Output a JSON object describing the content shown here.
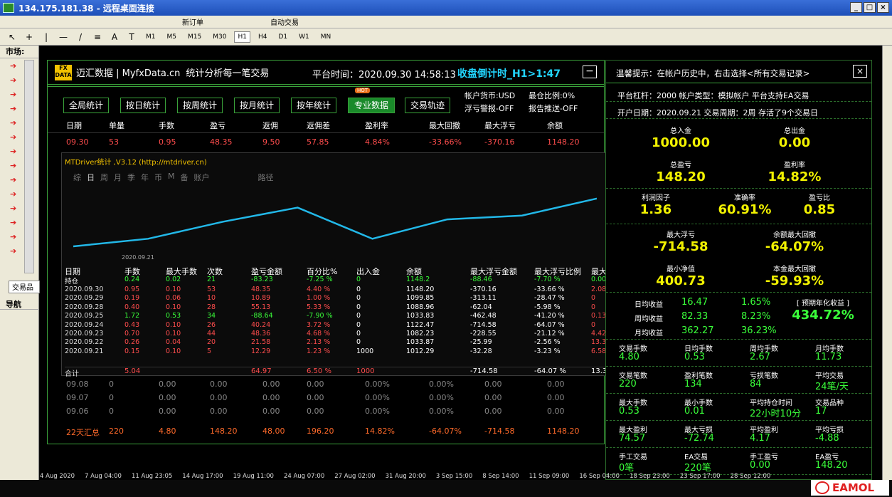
{
  "window": {
    "title": "134.175.181.38 - 远程桌面连接"
  },
  "toolbar_top": {
    "items": [
      "新订单",
      "自动交易"
    ]
  },
  "toolbar": {
    "timeframes": [
      "M1",
      "M5",
      "M15",
      "M30",
      "H1",
      "H4",
      "D1",
      "W1",
      "MN"
    ],
    "active": "H1"
  },
  "left_panel": {
    "market_title": "市场:",
    "tab_label": "交易品",
    "nav_title": "导航"
  },
  "main_panel": {
    "brand": "迈汇数据 | MyfxData.cn",
    "slogan": "统计分析每一笔交易",
    "platform_time": "平台时间：2020.09.30 14:58:13",
    "countdown": "收盘倒计时_H1>1:47",
    "tabs": [
      "全局统计",
      "按日统计",
      "按周统计",
      "按月统计",
      "按年统计",
      "专业数据",
      "交易轨迹"
    ],
    "active_tab": "专业数据",
    "hot_badge": "HOT",
    "info": [
      "帐户货币:USD",
      "浮亏警报-OFF",
      "最仓比例:0%",
      "报告推送-OFF"
    ],
    "columns": [
      "日期",
      "单量",
      "手数",
      "盈亏",
      "返佣",
      "返佣差",
      "盈利率",
      "最大回撤",
      "最大浮亏",
      "余额"
    ],
    "rows": [
      [
        "09.30",
        "53",
        "0.95",
        "48.35",
        "9.50",
        "57.85",
        "4.84%",
        "-33.66%",
        "-370.16",
        "1148.20"
      ]
    ],
    "grey_rows": [
      [
        "09.08",
        "0",
        "0.00",
        "0.00",
        "0.00",
        "0.00",
        "0.00%",
        "0.00%",
        "0.00",
        "0.00"
      ],
      [
        "09.07",
        "0",
        "0.00",
        "0.00",
        "0.00",
        "0.00",
        "0.00%",
        "0.00%",
        "0.00",
        "0.00"
      ],
      [
        "09.06",
        "0",
        "0.00",
        "0.00",
        "0.00",
        "0.00",
        "0.00%",
        "0.00%",
        "0.00",
        "0.00"
      ]
    ],
    "summary": [
      "22天汇总",
      "220",
      "4.80",
      "148.20",
      "48.00",
      "196.20",
      "14.82%",
      "-64.07%",
      "-714.58",
      "1148.20"
    ]
  },
  "sub_panel": {
    "title": "MTDriver统计 ,V3.12 (http://mtdriver.cn)",
    "tabs": [
      "综",
      "日",
      "周",
      "月",
      "季",
      "年",
      "币",
      "M",
      "备",
      "账户",
      "路径"
    ],
    "axis_date": "2020.09.21",
    "columns": [
      "日期",
      "手数",
      "最大手数",
      "次数",
      "盈亏金额",
      "百分比%",
      "出入金",
      "余额",
      "最大浮亏金额",
      "最大浮亏比例",
      "最大"
    ],
    "chart_data": {
      "type": "line",
      "x": [
        "09.21",
        "09.22",
        "09.23",
        "09.24",
        "09.25",
        "09.28",
        "09.29",
        "09.30"
      ],
      "values": [
        1012.29,
        1033.87,
        1082.23,
        1122.47,
        1033.83,
        1088.96,
        1099.85,
        1148.2
      ]
    },
    "hold_row": [
      "持仓",
      "0.24",
      "0.02",
      "21",
      "-83.23",
      "-7.25 %",
      "0",
      "1148.2",
      "-88.46",
      "-7.70 %",
      "0.00"
    ],
    "rows": [
      [
        "2020.09.30",
        "0.95",
        "0.10",
        "53",
        "48.35",
        "4.40 %",
        "0",
        "1148.20",
        "-370.16",
        "-33.66 %",
        "2.08"
      ],
      [
        "2020.09.29",
        "0.19",
        "0.06",
        "10",
        "10.89",
        "1.00 %",
        "0",
        "1099.85",
        "-313.11",
        "-28.47 %",
        "0"
      ],
      [
        "2020.09.28",
        "0.40",
        "0.10",
        "28",
        "55.13",
        "5.33 %",
        "0",
        "1088.96",
        "-62.04",
        "-5.98 %",
        "0"
      ],
      [
        "2020.09.25",
        "1.72",
        "0.53",
        "34",
        "-88.64",
        "-7.90 %",
        "0",
        "1033.83",
        "-462.48",
        "-41.20 %",
        "0.13"
      ],
      [
        "2020.09.24",
        "0.43",
        "0.10",
        "26",
        "40.24",
        "3.72 %",
        "0",
        "1122.47",
        "-714.58",
        "-64.07 %",
        "0"
      ],
      [
        "2020.09.23",
        "0.70",
        "0.10",
        "44",
        "48.36",
        "4.68 %",
        "0",
        "1082.23",
        "-228.55",
        "-21.12 %",
        "4.42"
      ],
      [
        "2020.09.22",
        "0.26",
        "0.04",
        "20",
        "21.58",
        "2.13 %",
        "0",
        "1033.87",
        "-25.99",
        "-2.56 %",
        "13.3"
      ],
      [
        "2020.09.21",
        "0.15",
        "0.10",
        "5",
        "12.29",
        "1.23 %",
        "1000",
        "1012.29",
        "-32.28",
        "-3.23 %",
        "6.58"
      ]
    ],
    "total": [
      "合计",
      "5.04",
      "",
      "",
      "64.97",
      "6.50 %",
      "1000",
      "",
      "-714.58",
      "-64.07 %",
      "13.3"
    ]
  },
  "right_panel": {
    "tip": "温馨提示：在帐户历史中，右击选择<所有交易记录>",
    "line1": "平台杠杆：2000     帐户类型：模拟帐户     平台支持EA交易",
    "line2": "开户日期：2020.09.21     交易周期：2周     存活了9个交易日",
    "big": [
      {
        "label": "总入金",
        "value": "1000.00"
      },
      {
        "label": "总出金",
        "value": "0.00"
      },
      {
        "label": "总盈亏",
        "value": "148.20"
      },
      {
        "label": "盈利率",
        "value": "14.82%"
      }
    ],
    "mid": [
      {
        "label": "利润因子",
        "value": "1.36"
      },
      {
        "label": "准确率",
        "value": "60.91%"
      },
      {
        "label": "盈亏比",
        "value": "0.85"
      }
    ],
    "dd": [
      {
        "label": "最大浮亏",
        "value": "-714.58"
      },
      {
        "label": "余额最大回撤",
        "value": "-64.07%"
      },
      {
        "label": "最小净值",
        "value": "400.73"
      },
      {
        "label": "本金最大回撤",
        "value": "-59.93%"
      }
    ],
    "income": [
      {
        "label": "日均收益",
        "value": "16.47",
        "pct": "1.65%"
      },
      {
        "label": "周均收益",
        "value": "82.33",
        "pct": "8.23%"
      },
      {
        "label": "月均收益",
        "value": "362.27",
        "pct": "36.23%"
      }
    ],
    "annual_label": "[ 预期年化收益 ]",
    "annual_value": "434.72%",
    "grid": [
      [
        {
          "l": "交易手数",
          "v": "4.80"
        },
        {
          "l": "日均手数",
          "v": "0.53"
        },
        {
          "l": "周均手数",
          "v": "2.67"
        },
        {
          "l": "月均手数",
          "v": "11.73"
        }
      ],
      [
        {
          "l": "交易笔数",
          "v": "220"
        },
        {
          "l": "盈利笔数",
          "v": "134"
        },
        {
          "l": "亏损笔数",
          "v": "84"
        },
        {
          "l": "平均交易",
          "v": "24笔/天"
        }
      ],
      [
        {
          "l": "最大手数",
          "v": "0.53"
        },
        {
          "l": "最小手数",
          "v": "0.01"
        },
        {
          "l": "平均持仓时间",
          "v": "22小时10分"
        },
        {
          "l": "交易品种",
          "v": "17"
        }
      ],
      [
        {
          "l": "最大盈利",
          "v": "74.57"
        },
        {
          "l": "最大亏损",
          "v": "-72.74"
        },
        {
          "l": "平均盈利",
          "v": "4.17"
        },
        {
          "l": "平均亏损",
          "v": "-4.88"
        }
      ],
      [
        {
          "l": "手工交易",
          "v": "0笔"
        },
        {
          "l": "EA交易",
          "v": "220笔"
        },
        {
          "l": "手工盈亏",
          "v": "0.00"
        },
        {
          "l": "EA盈亏",
          "v": "148.20"
        }
      ]
    ]
  },
  "date_axis": [
    "4 Aug 2020",
    "7 Aug 04:00",
    "11 Aug 23:05",
    "14 Aug 17:00",
    "19 Aug 11:00",
    "24 Aug 07:00",
    "27 Aug 02:00",
    "31 Aug 20:00",
    "3 Sep 15:00",
    "8 Sep 14:00",
    "11 Sep 09:00",
    "16 Sep 04:00",
    "18 Sep 23:00",
    "23 Sep 17:00",
    "28 Sep 12:00"
  ],
  "watermark": "EAMOL",
  "colors": {
    "green_border": "#3aa23a",
    "yellow": "#f2f200",
    "cyan": "#22d6ff",
    "red": "#ff4d4d"
  }
}
